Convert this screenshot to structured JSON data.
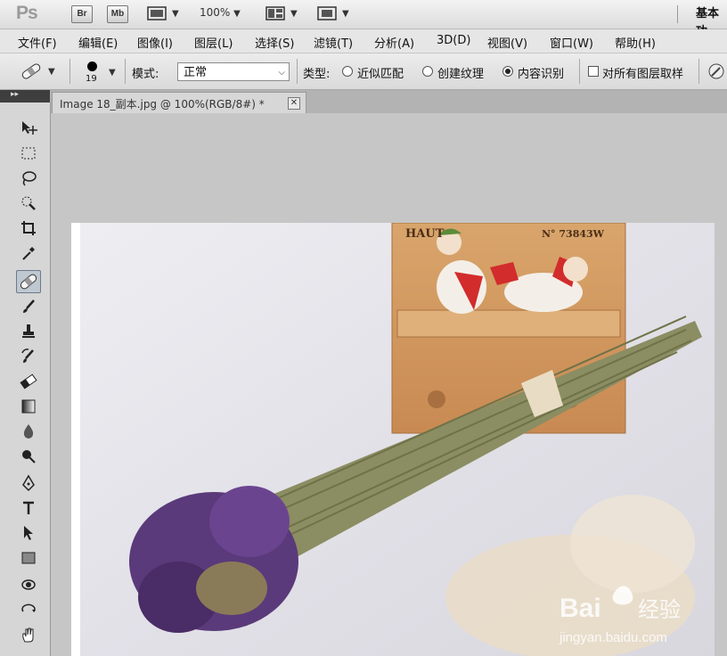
{
  "app": {
    "logo": "Ps",
    "bridge": "Br",
    "minibridge": "Mb",
    "zoom": "100%",
    "workspace": "基本功"
  },
  "menu": [
    "文件(F)",
    "编辑(E)",
    "图像(I)",
    "图层(L)",
    "选择(S)",
    "滤镜(T)",
    "分析(A)",
    "3D(D)",
    "视图(V)",
    "窗口(W)",
    "帮助(H)"
  ],
  "options": {
    "brush_size": "19",
    "mode_label": "模式:",
    "mode_value": "正常",
    "type_label": "类型:",
    "type_options": [
      "近似匹配",
      "创建纹理",
      "内容识别"
    ],
    "type_selected": "内容识别",
    "sample_all_layers": "对所有图层取样"
  },
  "document": {
    "tab_title": "Image 18_副本.jpg @ 100%(RGB/8#) *"
  },
  "photo_text": {
    "sign_left": "HAUT",
    "sign_right": "N° 73843W"
  },
  "watermark": {
    "brand": "Bai",
    "brand_suffix": "经验",
    "url": "jingyan.baidu.com"
  },
  "colors": {
    "chrome": "#dcdcdc",
    "canvas": "#c6c6c6",
    "active_tool": "#bfc7d0"
  }
}
